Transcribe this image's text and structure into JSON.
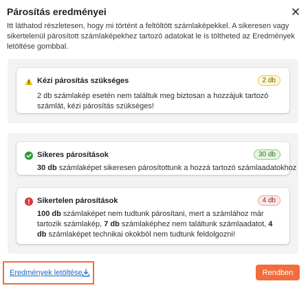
{
  "dialog": {
    "title": "Párosítás eredményei",
    "description": "Itt láthatod részletesen, hogy mi történt a feltöltött számlaképekkel. A sikeresen vagy sikertelenül párosított számlaképekhez tartozó adatokat le is töltheted az Eredmények letöltése gombbal."
  },
  "manual": {
    "title": "Kézi párosítás szükséges",
    "badge": "2 db",
    "text": "2 db számlakép esetén nem találtuk meg biztosan a hozzájuk tartozó számlát, kézi párosítás szükséges!"
  },
  "success": {
    "title": "Sikeres párosítások",
    "badge": "30 db",
    "count": "30 db",
    "text": " számlaképet sikeresen párosítottunk a hozzá tartozó számlaadatokhoz"
  },
  "failed": {
    "title": "Sikertelen párosítások",
    "badge": "4 db",
    "count1": "100 db",
    "text1": " számlaképet nem tudtunk párosítani, mert a számlához már tartozik számlakép, ",
    "count2": "7 db",
    "text2": " számlaképhez nem találtunk számlaadatot, ",
    "count3": "4 db",
    "text3": " számlaképet technikai okokból nem tudtunk feldolgozni!"
  },
  "footer": {
    "download_label": "Eredmények letöltése",
    "ok_label": "Rendben"
  },
  "colors": {
    "accent": "#f26c3d",
    "link": "#2168c4",
    "warning": "#f2c200",
    "success": "#2f9a3a",
    "error": "#d33a3a"
  },
  "icons": {
    "close": "close-icon",
    "warning": "warning-icon",
    "success": "check-circle-icon",
    "error": "error-circle-icon",
    "download": "download-icon"
  }
}
